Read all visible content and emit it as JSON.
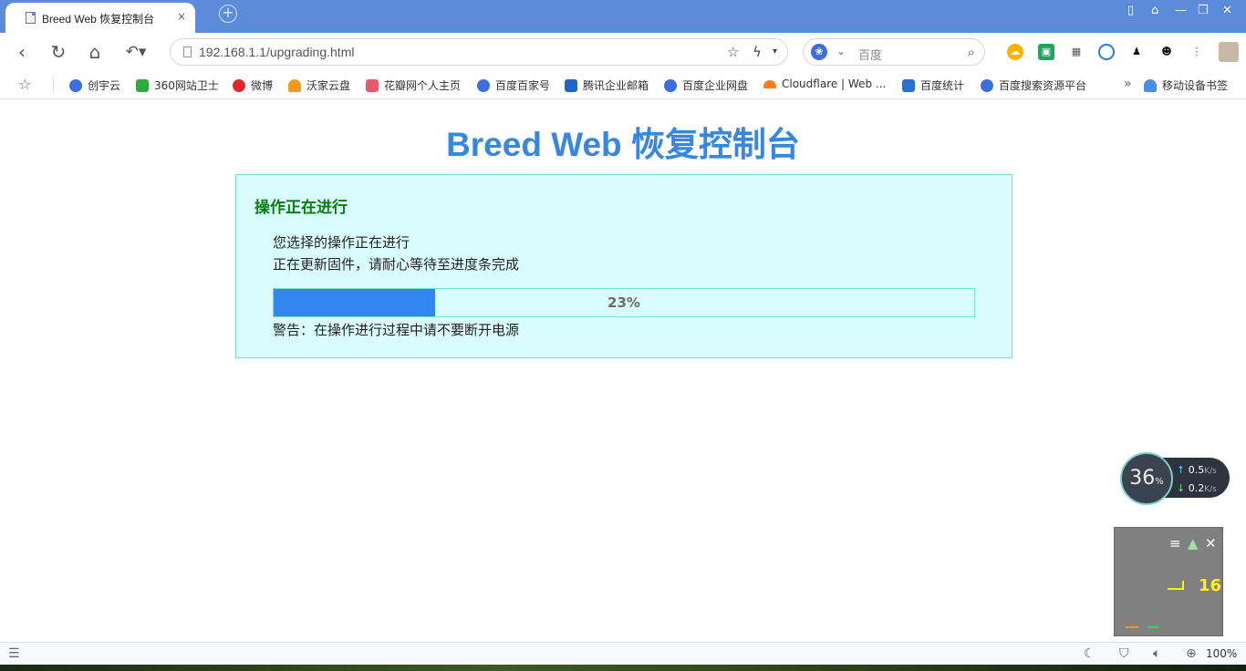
{
  "browser": {
    "tab": {
      "title": "Breed Web 恢复控制台",
      "close": "×"
    },
    "new_tab": "+",
    "window_controls": [
      "▯",
      "⌂",
      "—",
      "❐",
      "✕"
    ],
    "address": {
      "url": "192.168.1.1/upgrading.html"
    },
    "search": {
      "placeholder": "百度",
      "engine_icon": "baidu-paw-icon"
    },
    "bookmarks": [
      {
        "label": "创宇云",
        "color": "#3b6fe0"
      },
      {
        "label": "360网站卫士",
        "color": "#2eaa3c"
      },
      {
        "label": "微博",
        "color": "#e2272d"
      },
      {
        "label": "沃家云盘",
        "color": "#f39a1e"
      },
      {
        "label": "花瓣网个人主页",
        "color": "#e65b6b"
      },
      {
        "label": "百度百家号",
        "color": "#3b6fe0"
      },
      {
        "label": "腾讯企业邮箱",
        "color": "#1f66c6"
      },
      {
        "label": "百度企业网盘",
        "color": "#3b6fe0"
      },
      {
        "label": "Cloudflare | Web ...",
        "color": "#f38020"
      },
      {
        "label": "百度统计",
        "color": "#2a6fd6"
      },
      {
        "label": "百度搜索资源平台",
        "color": "#3b6fe0"
      }
    ],
    "bookmarks_more": "»",
    "mobile_bookmarks": "移动设备书签",
    "zoom": "100%"
  },
  "page": {
    "title": "Breed Web 恢复控制台",
    "panel": {
      "heading": "操作正在进行",
      "line1": "您选择的操作正在进行",
      "line2": "正在更新固件，请耐心等待至进度条完成",
      "progress_value": 23,
      "progress_label": "23%",
      "warning": "警告：在操作进行过程中请不要断开电源"
    }
  },
  "widgets": {
    "speed": {
      "percent": "36",
      "percent_sign": "%",
      "up": "0.5",
      "down": "0.2",
      "unit": "K/s"
    },
    "game": {
      "number": "16"
    }
  },
  "colors": {
    "title": "#3786e0",
    "panel_bg": "#d9fdfd",
    "panel_border": "#7adbd0",
    "heading": "#0c7a12",
    "progress_fill": "#3186f0",
    "tabstrip": "#5b8bd9"
  }
}
